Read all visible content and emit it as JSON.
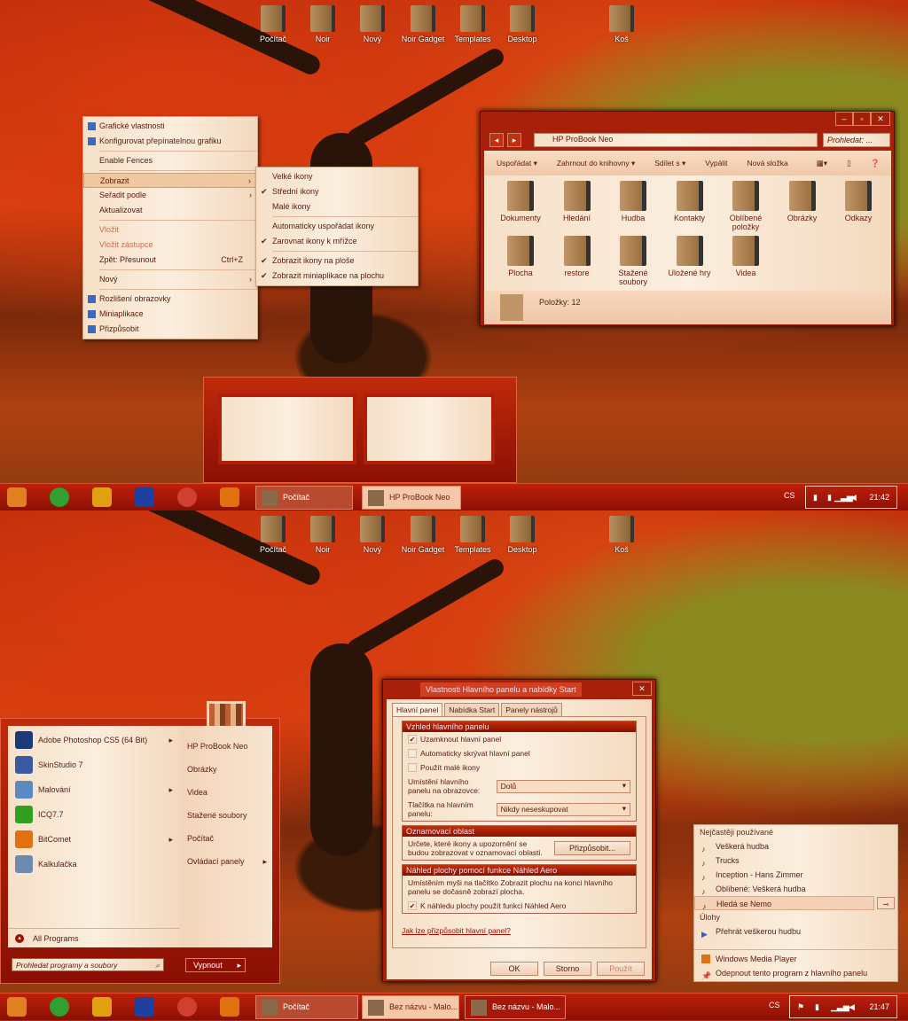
{
  "desktop_icons": [
    "Počítač",
    "Noir",
    "Nový",
    "Noir Gadget",
    "Templates",
    "Desktop",
    "Koš"
  ],
  "context_menu": {
    "items": [
      {
        "label": "Grafické vlastnosti",
        "icon": "graphics-icon"
      },
      {
        "label": "Konfigurovat přepínatelnou grafiku",
        "icon": "graphics-icon"
      },
      {
        "sep": true
      },
      {
        "label": "Enable Fences"
      },
      {
        "sep": true
      },
      {
        "label": "Zobrazit",
        "submenu": true,
        "highlighted": true
      },
      {
        "label": "Seřadit podle",
        "submenu": true
      },
      {
        "label": "Aktualizovat"
      },
      {
        "sep": true
      },
      {
        "label": "Vložit",
        "disabled": true
      },
      {
        "label": "Vložit zástupce",
        "disabled": true
      },
      {
        "label": "Zpět: Přesunout",
        "shortcut": "Ctrl+Z"
      },
      {
        "sep": true
      },
      {
        "label": "Nový",
        "submenu": true
      },
      {
        "sep": true
      },
      {
        "label": "Rozlišení obrazovky",
        "icon": "display-icon"
      },
      {
        "label": "Miniaplikace",
        "icon": "gadgets-icon"
      },
      {
        "label": "Přizpůsobit",
        "icon": "personalize-icon"
      }
    ]
  },
  "submenu": {
    "items": [
      {
        "label": "Velké ikony"
      },
      {
        "label": "Střední ikony",
        "checked": true
      },
      {
        "label": "Malé ikony"
      },
      {
        "sep": true
      },
      {
        "label": "Automaticky uspořádat ikony"
      },
      {
        "label": "Zarovnat ikony k mřížce",
        "checked": true
      },
      {
        "sep": true
      },
      {
        "label": "Zobrazit ikony na ploše",
        "checked": true
      },
      {
        "label": "Zobrazit miniaplikace na plochu",
        "checked": true
      }
    ]
  },
  "explorer": {
    "path": "HP ProBook Neo",
    "search_placeholder": "Prohledat: ...",
    "toolbar": [
      "Uspořádat",
      "Zahrnout do knihovny",
      "Sdílet s",
      "Vypálit",
      "Nová složka"
    ],
    "items": [
      "Dokumenty",
      "Hledání",
      "Hudba",
      "Kontakty",
      "Oblíbené položky",
      "Obrázky",
      "Odkazy",
      "Plocha",
      "restore",
      "Stažené soubory",
      "Uložené hry",
      "Videa"
    ],
    "status": "Položky: 12"
  },
  "taskbar_top": {
    "buttons": [
      "Počítač",
      "HP ProBook Neo"
    ],
    "lang": "CS",
    "clock": "21:42"
  },
  "taskbar_bottom": {
    "buttons": [
      "Počítač",
      "Bez názvu - Malo...",
      "Bez názvu - Malo..."
    ],
    "lang": "CS",
    "clock": "21:47"
  },
  "start_menu": {
    "programs": [
      {
        "label": "Adobe Photoshop CS5 (64 Bit)",
        "arrow": true,
        "color": "#1a3a7a"
      },
      {
        "label": "SkinStudio 7",
        "color": "#3a5aa0"
      },
      {
        "label": "Malování",
        "arrow": true,
        "color": "#5a8ac0"
      },
      {
        "label": "ICQ7.7",
        "color": "#30a020"
      },
      {
        "label": "BitComet",
        "arrow": true,
        "color": "#e07010"
      },
      {
        "label": "Kalkulačka",
        "color": "#6a8ab0"
      }
    ],
    "all_programs": "All Programs",
    "right": [
      {
        "label": "HP ProBook Neo"
      },
      {
        "label": "Obrázky"
      },
      {
        "label": "Videa"
      },
      {
        "label": "Stažené soubory"
      },
      {
        "label": "Počítač"
      },
      {
        "label": "Ovládací panely",
        "arrow": true
      }
    ],
    "search_placeholder": "Prohledat programy a soubory",
    "shutdown": "Vypnout"
  },
  "dialog": {
    "title": "Vlastnosti Hlavního panelu a nabídky Start",
    "tabs": [
      "Hlavní panel",
      "Nabídka Start",
      "Panely nástrojů"
    ],
    "group1": {
      "title": "Vzhled hlavního panelu",
      "checks": [
        {
          "label": "Uzamknout hlavní panel",
          "checked": true
        },
        {
          "label": "Automaticky skrývat hlavní panel",
          "checked": false
        },
        {
          "label": "Použít malé ikony",
          "checked": false
        }
      ],
      "position_label": "Umístění hlavního panelu na obrazovce:",
      "position_value": "Dolů",
      "buttons_label": "Tlačítka na hlavním panelu:",
      "buttons_value": "Nikdy neseskupovat"
    },
    "group2": {
      "title": "Oznamovací oblast",
      "text": "Určete, které ikony a upozornění se budou zobrazovat v oznamovací oblasti.",
      "button": "Přizpůsobit..."
    },
    "group3": {
      "title": "Náhled plochy pomocí funkce Náhled Aero",
      "text": "Umístěním myši na tlačítko Zobrazit plochu na konci hlavního panelu se dočasně zobrazí plocha.",
      "check": "K náhledu plochy použít funkci Náhled Aero"
    },
    "link": "Jak lze přizpůsobit hlavní panel?",
    "ok": "OK",
    "cancel": "Storno",
    "apply": "Použít"
  },
  "jumplist": {
    "frequent_header": "Nejčastěji používané",
    "frequent": [
      "Veškerá hudba",
      "Trucks",
      "Inception - Hans Zimmer",
      "Oblíbené: Veškerá hudba",
      "Hledá se Nemo"
    ],
    "tasks_header": "Úlohy",
    "tasks": [
      "Přehrát veškerou hudbu"
    ],
    "app": "Windows Media Player",
    "unpin": "Odepnout tento program z hlavního panelu"
  },
  "colors": {
    "accent": "#a8200a",
    "panel": "#f6e0c8"
  }
}
